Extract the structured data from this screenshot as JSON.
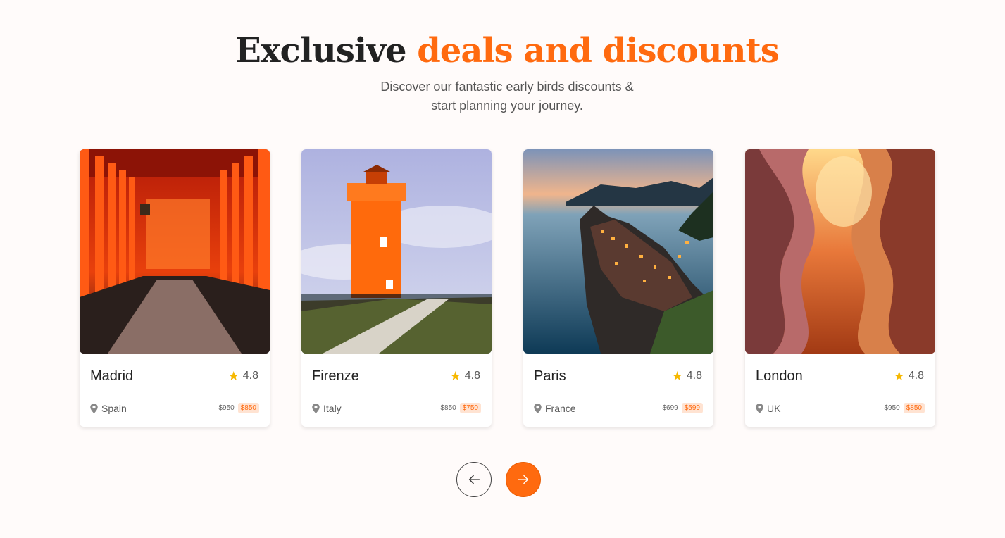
{
  "heading": {
    "plain": "Exclusive",
    "accent": "deals and discounts"
  },
  "subtitle": {
    "line1": "Discover our fantastic early birds discounts &",
    "line2": "start planning your journey."
  },
  "colors": {
    "accent": "#ff6a0f",
    "star": "#f6b800",
    "background": "#fffbfa"
  },
  "cards": [
    {
      "title": "Madrid",
      "rating": "4.8",
      "location": "Spain",
      "old_price": "$950",
      "new_price": "$850",
      "image": "torii-gates-path"
    },
    {
      "title": "Firenze",
      "rating": "4.8",
      "location": "Italy",
      "old_price": "$850",
      "new_price": "$750",
      "image": "orange-lighthouse"
    },
    {
      "title": "Paris",
      "rating": "4.8",
      "location": "France",
      "old_price": "$699",
      "new_price": "$599",
      "image": "coastal-village-dusk"
    },
    {
      "title": "London",
      "rating": "4.8",
      "location": "UK",
      "old_price": "$950",
      "new_price": "$850",
      "image": "sandstone-canyon"
    }
  ],
  "icons": {
    "star": "star-icon",
    "pin": "location-pin-icon",
    "prev": "arrow-left-icon",
    "next": "arrow-right-icon"
  }
}
